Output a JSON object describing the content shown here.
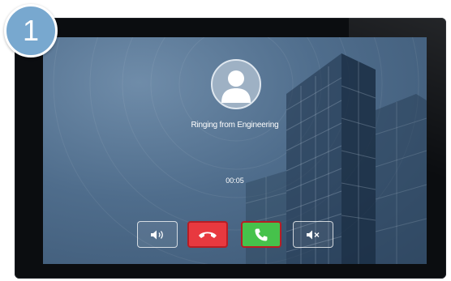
{
  "step_badge": {
    "number": "1"
  },
  "call": {
    "status_text": "Ringing from Engineering",
    "duration": "00:05"
  },
  "controls": {
    "speaker": {
      "icon": "speaker-icon"
    },
    "decline": {
      "icon": "hang-up-icon",
      "color": "#e8393f"
    },
    "answer": {
      "icon": "phone-answer-icon",
      "color": "#46c24b"
    },
    "mute": {
      "icon": "mute-icon"
    }
  },
  "colors": {
    "screen_bg": "#4f6d8c",
    "badge": "#78a8cf",
    "highlight_outline": "#b71d24"
  }
}
